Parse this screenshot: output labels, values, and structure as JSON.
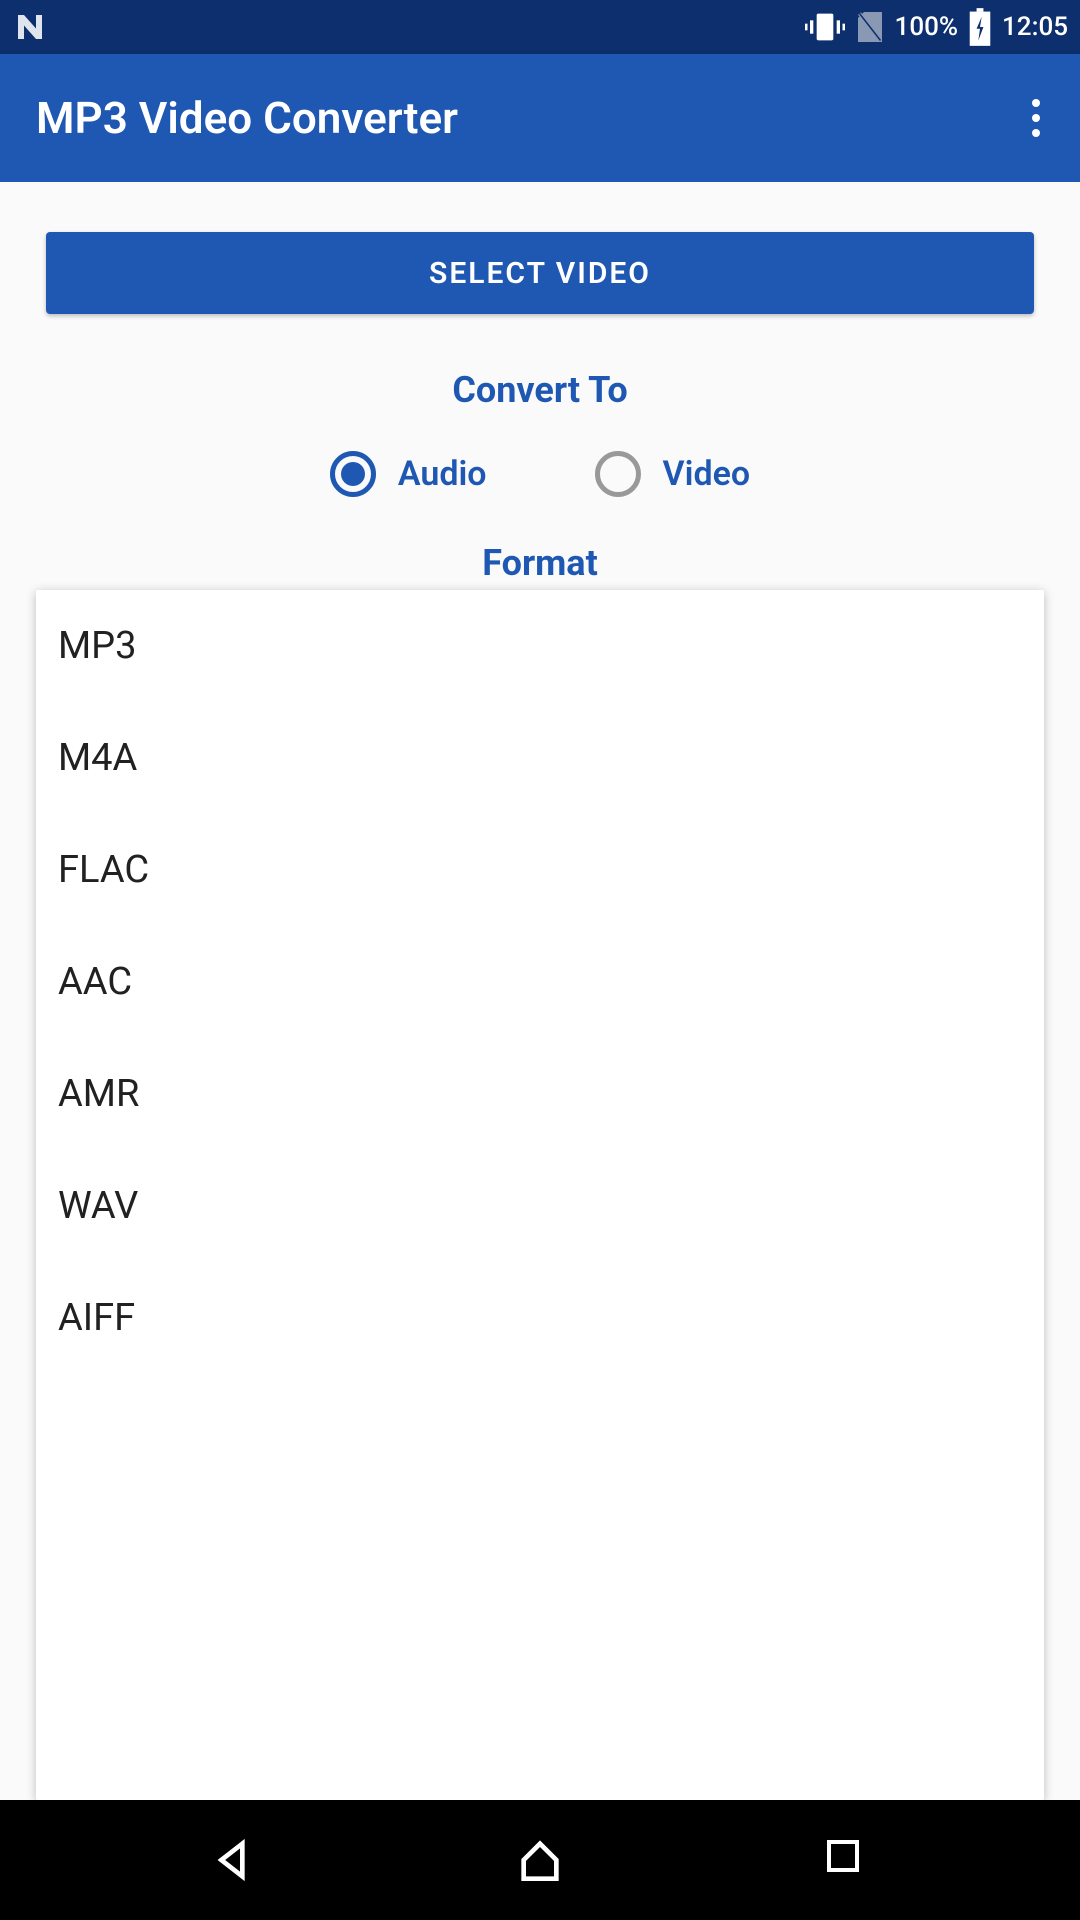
{
  "statusBar": {
    "nIconColor": "#dfe4ed",
    "batteryPercent": "100%",
    "time": "12:05"
  },
  "appBar": {
    "title": "MP3 Video Converter"
  },
  "main": {
    "selectButtonLabel": "SELECT VIDEO",
    "convertToLabel": "Convert To",
    "radioOptions": {
      "audio": "Audio",
      "video": "Video"
    },
    "formatLabel": "Format",
    "formatOptions": [
      "MP3",
      "M4A",
      "FLAC",
      "AAC",
      "AMR",
      "WAV",
      "AIFF"
    ]
  }
}
